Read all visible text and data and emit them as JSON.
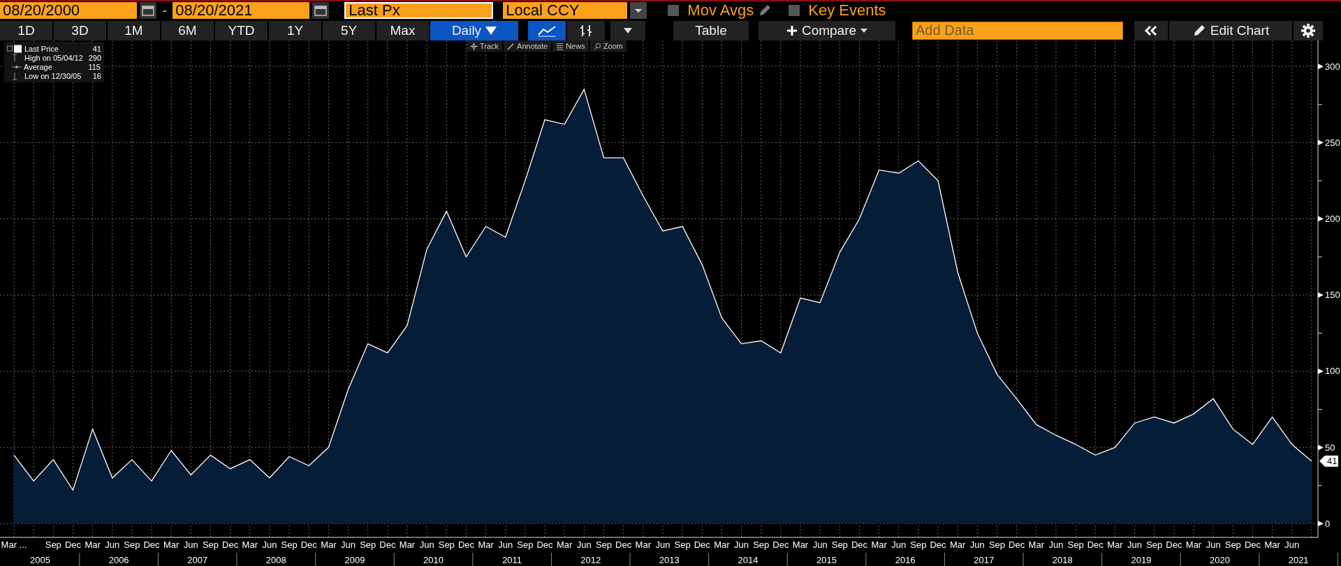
{
  "toolbar": {
    "date_from": "08/20/2000",
    "separator": "-",
    "date_to": "08/20/2021",
    "field": "Last Px",
    "currency": "Local CCY",
    "toggles": [
      {
        "label": "Mov Avgs",
        "checked": false,
        "kind": "edit"
      },
      {
        "label": "Key Events",
        "checked": false,
        "kind": "plain"
      }
    ]
  },
  "controls": {
    "periods": [
      {
        "label": "1D",
        "selected": false
      },
      {
        "label": "3D",
        "selected": false
      },
      {
        "label": "1M",
        "selected": false
      },
      {
        "label": "6M",
        "selected": false
      },
      {
        "label": "YTD",
        "selected": false
      },
      {
        "label": "1Y",
        "selected": false
      },
      {
        "label": "5Y",
        "selected": false
      },
      {
        "label": "Max",
        "selected": false
      }
    ],
    "frequency": "Daily",
    "chart_types": [
      {
        "kind": "line",
        "selected": true
      },
      {
        "kind": "candles",
        "selected": false
      }
    ],
    "table": "Table",
    "compare": "Compare",
    "add_data_placeholder": "Add Data",
    "edit_chart": "Edit Chart"
  },
  "chart_tools": [
    {
      "label": "Track",
      "kind": "track"
    },
    {
      "label": "Annotate",
      "kind": "annotate"
    },
    {
      "label": "News",
      "kind": "news"
    },
    {
      "label": "Zoom",
      "kind": "zoom"
    }
  ],
  "legend": [
    {
      "label": "Last Price",
      "value": "41",
      "kind": "series"
    },
    {
      "label": "High on 05/04/12",
      "value": "290",
      "kind": "high"
    },
    {
      "label": "Average",
      "value": "115",
      "kind": "average"
    },
    {
      "label": "Low on 12/30/05",
      "value": "16",
      "kind": "low"
    }
  ],
  "chart": {
    "last_price_tag": "41",
    "year_labels": [
      "2005",
      "2006",
      "2007",
      "2008",
      "2009",
      "2010",
      "2011",
      "2012",
      "2013",
      "2014",
      "2015",
      "2016",
      "2017",
      "2018",
      "2019",
      "2020",
      "2021"
    ],
    "chart_data": {
      "type": "area",
      "grid": true,
      "ylim": [
        -9,
        317
      ],
      "yticks": [
        0,
        50,
        100,
        150,
        200,
        250,
        300
      ],
      "categories": [
        "Mar ...",
        null,
        "Sep",
        "Dec",
        "Mar",
        "Jun",
        "Sep",
        "Dec",
        "Mar",
        "Jun",
        "Sep",
        "Dec",
        "Mar",
        "Jun",
        "Sep",
        "Dec",
        "Mar",
        "Jun",
        "Sep",
        "Dec",
        "Mar",
        "Jun",
        "Sep",
        "Dec",
        "Mar",
        "Jun",
        "Sep",
        "Dec",
        "Mar",
        "Jun",
        "Sep",
        "Dec",
        "Mar",
        "Jun",
        "Sep",
        "Dec",
        "Mar",
        "Jun",
        "Sep",
        "Dec",
        "Mar",
        "Jun",
        "Sep",
        "Dec",
        "Mar",
        "Jun",
        "Sep",
        "Dec",
        "Mar",
        "Jun",
        "Sep",
        "Dec",
        "Mar",
        "Jun",
        "Sep",
        "Dec",
        "Mar",
        "Jun",
        "Sep",
        "Dec",
        "Mar",
        "Jun",
        "Sep",
        "Dec",
        "Mar",
        "Jun",
        null
      ],
      "series": [
        {
          "color": "#ffffff",
          "values": [
            45,
            28,
            42,
            22,
            62,
            30,
            42,
            28,
            48,
            32,
            45,
            36,
            42,
            30,
            44,
            38,
            50,
            88,
            118,
            112,
            130,
            180,
            205,
            175,
            195,
            188,
            225,
            265,
            262,
            285,
            240,
            240,
            215,
            192,
            195,
            170,
            135,
            118,
            120,
            112,
            148,
            145,
            178,
            200,
            232,
            230,
            238,
            225,
            165,
            125,
            98,
            82,
            65,
            58,
            52,
            45,
            50,
            66,
            70,
            66,
            72,
            82,
            62,
            52,
            70,
            52,
            41
          ]
        }
      ]
    }
  }
}
